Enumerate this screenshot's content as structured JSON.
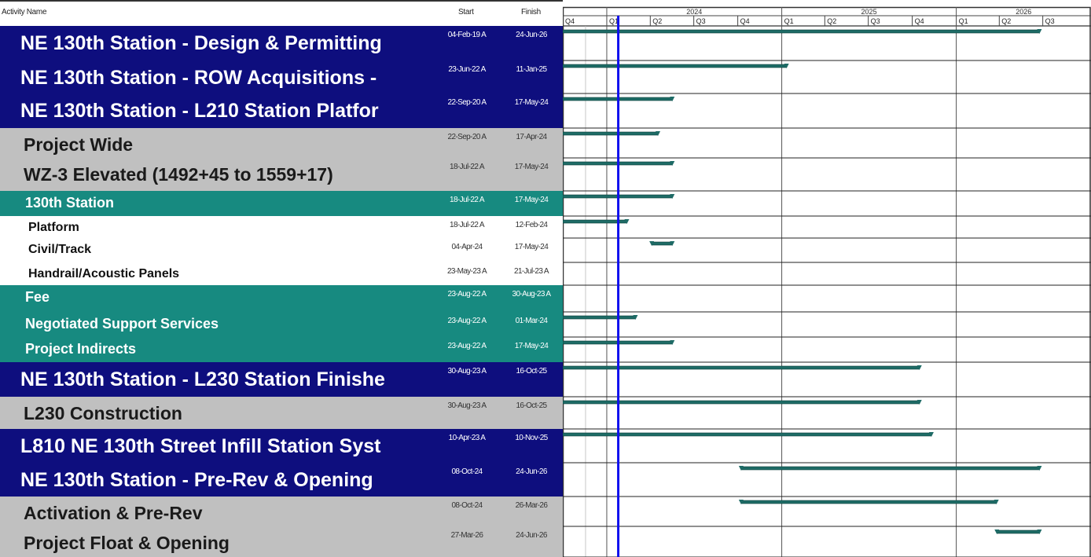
{
  "header": {
    "activity_name": "Activity Name",
    "start": "Start",
    "finish": "Finish",
    "years": [
      "2024",
      "2025",
      "2026"
    ],
    "quarters": [
      "Q4",
      "Q1",
      "Q2",
      "Q3",
      "Q4",
      "Q1",
      "Q2",
      "Q3",
      "Q4",
      "Q1",
      "Q2",
      "Q3"
    ]
  },
  "colors": {
    "wbs_level1": "#0e0e7e",
    "wbs_level2": "#c0c0c0",
    "wbs_level3": "#178a80",
    "activity": "#ffffff",
    "bar": "#1e6b66",
    "data_date_line": "#1010ee"
  },
  "timeline": {
    "axis_start": "2023-10-01",
    "axis_end": "2026-09-30",
    "data_date": "2024-01-25"
  },
  "rows": [
    {
      "name": "NE 130th Station - Design & Permitting",
      "start": "04-Feb-19 A",
      "finish": "24-Jun-26",
      "level": "blue",
      "bar_finish": "2026-06-24"
    },
    {
      "name": "NE 130th Station - ROW Acquisitions -",
      "start": "23-Jun-22 A",
      "finish": "11-Jan-25",
      "level": "blue",
      "bar_finish": "2025-01-11"
    },
    {
      "name": "NE 130th Station - L210 Station Platfor",
      "start": "22-Sep-20 A",
      "finish": "17-May-24",
      "level": "blue",
      "bar_finish": "2024-05-17"
    },
    {
      "name": "Project Wide",
      "start": "22-Sep-20 A",
      "finish": "17-Apr-24",
      "level": "gray",
      "bar_finish": "2024-04-17"
    },
    {
      "name": "WZ-3 Elevated  (1492+45 to 1559+17)",
      "start": "18-Jul-22 A",
      "finish": "17-May-24",
      "level": "gray",
      "bar_finish": "2024-05-17"
    },
    {
      "name": "130th Station",
      "start": "18-Jul-22 A",
      "finish": "17-May-24",
      "level": "teal",
      "bar_finish": "2024-05-17"
    },
    {
      "name": "Platform",
      "start": "18-Jul-22 A",
      "finish": "12-Feb-24",
      "level": "white",
      "bar_finish": "2024-02-12"
    },
    {
      "name": "Civil/Track",
      "start": "04-Apr-24",
      "finish": "17-May-24",
      "level": "white",
      "bar_start": "2024-04-04",
      "bar_finish": "2024-05-17"
    },
    {
      "name": "Handrail/Acoustic Panels",
      "start": "23-May-23 A",
      "finish": "21-Jul-23 A",
      "level": "white"
    },
    {
      "name": "Fee",
      "start": "23-Aug-22 A",
      "finish": "30-Aug-23 A",
      "level": "teal"
    },
    {
      "name": "Negotiated Support Services",
      "start": "23-Aug-22 A",
      "finish": "01-Mar-24",
      "level": "teal",
      "bar_finish": "2024-03-01"
    },
    {
      "name": "Project Indirects",
      "start": "23-Aug-22 A",
      "finish": "17-May-24",
      "level": "teal",
      "bar_finish": "2024-05-17"
    },
    {
      "name": "NE 130th Station - L230 Station Finishe",
      "start": "30-Aug-23 A",
      "finish": "16-Oct-25",
      "level": "blue",
      "bar_finish": "2025-10-16"
    },
    {
      "name": "L230 Construction",
      "start": "30-Aug-23 A",
      "finish": "16-Oct-25",
      "level": "gray",
      "bar_finish": "2025-10-16"
    },
    {
      "name": "L810 NE 130th Street Infill Station Syst",
      "start": "10-Apr-23 A",
      "finish": "10-Nov-25",
      "level": "blue",
      "bar_finish": "2025-11-10"
    },
    {
      "name": "NE 130th Station - Pre-Rev & Opening",
      "start": "08-Oct-24",
      "finish": "24-Jun-26",
      "level": "blue",
      "bar_start": "2024-10-08",
      "bar_finish": "2026-06-24"
    },
    {
      "name": "Activation & Pre-Rev",
      "start": "08-Oct-24",
      "finish": "26-Mar-26",
      "level": "gray",
      "bar_start": "2024-10-08",
      "bar_finish": "2026-03-26"
    },
    {
      "name": "Project Float & Opening",
      "start": "27-Mar-26",
      "finish": "24-Jun-26",
      "level": "gray",
      "bar_start": "2026-03-27",
      "bar_finish": "2026-06-24"
    }
  ]
}
